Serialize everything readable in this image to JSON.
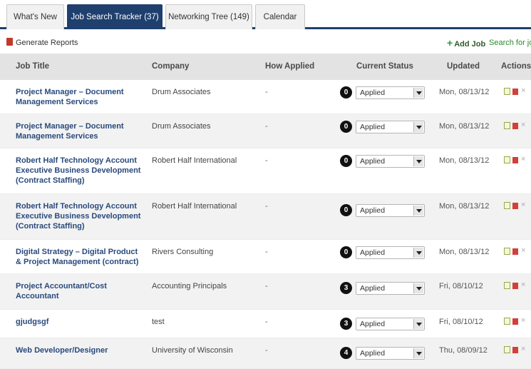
{
  "tabs": [
    {
      "label": "What's New",
      "active": false
    },
    {
      "label": "Job Search Tracker (37)",
      "active": true
    },
    {
      "label": "Networking Tree (149)",
      "active": false
    },
    {
      "label": "Calendar",
      "active": false
    }
  ],
  "toolbar": {
    "generate_reports": "Generate Reports",
    "add_job": "Add Job",
    "search_jobs": "Search for job"
  },
  "columns": {
    "job_title": "Job Title",
    "company": "Company",
    "how_applied": "How Applied",
    "current_status": "Current Status",
    "updated": "Updated",
    "actions": "Actions"
  },
  "rows": [
    {
      "job": "Project Manager – Document Management Services",
      "company": "Drum Associates",
      "how": "-",
      "badge": "0",
      "status": "Applied",
      "updated": "Mon, 08/13/12"
    },
    {
      "job": "Project Manager – Document Management Services",
      "company": "Drum Associates",
      "how": "-",
      "badge": "0",
      "status": "Applied",
      "updated": "Mon, 08/13/12"
    },
    {
      "job": "Robert Half Technology Account Executive Business Development (Contract Staffing)",
      "company": "Robert Half International",
      "how": "-",
      "badge": "0",
      "status": "Applied",
      "updated": "Mon, 08/13/12"
    },
    {
      "job": "Robert Half Technology Account Executive Business Development (Contract Staffing)",
      "company": "Robert Half International",
      "how": "-",
      "badge": "0",
      "status": "Applied",
      "updated": "Mon, 08/13/12"
    },
    {
      "job": "Digital Strategy – Digital Product & Project Management (contract)",
      "company": "Rivers Consulting",
      "how": "-",
      "badge": "0",
      "status": "Applied",
      "updated": "Mon, 08/13/12"
    },
    {
      "job": "Project Accountant/Cost Accountant",
      "company": "Accounting Principals",
      "how": "-",
      "badge": "3",
      "status": "Applied",
      "updated": "Fri, 08/10/12"
    },
    {
      "job": "gjudgsgf",
      "company": "test",
      "how": "-",
      "badge": "3",
      "status": "Applied",
      "updated": "Fri, 08/10/12"
    },
    {
      "job": "Web Developer/Designer",
      "company": "University of Wisconsin",
      "how": "-",
      "badge": "4",
      "status": "Applied",
      "updated": "Thu, 08/09/12"
    }
  ],
  "colors": {
    "active_tab": "#1f3f6e",
    "header_bg": "#e3e3e3",
    "alt_row": "#f2f2f2",
    "job_title": "#2a4a7c",
    "add_job_plus": "#2e9a2e"
  },
  "icons": [
    "pdf-icon",
    "plus-icon",
    "edit-icon",
    "delete-icon",
    "close-icon",
    "dropdown-caret-icon"
  ]
}
